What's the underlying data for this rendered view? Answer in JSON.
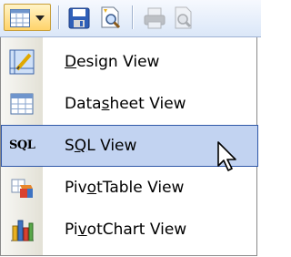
{
  "toolbar": {
    "buttons": [
      {
        "name": "view-dropdown-button",
        "icon": "datasheet-grid-icon"
      },
      {
        "name": "save-button",
        "icon": "save-disk-icon"
      },
      {
        "name": "file-search-button",
        "icon": "file-search-icon"
      },
      {
        "name": "print-button",
        "icon": "printer-icon"
      },
      {
        "name": "print-preview-button",
        "icon": "print-preview-icon"
      }
    ]
  },
  "menu": {
    "items": [
      {
        "id": "design",
        "pre": "",
        "key": "D",
        "post": "esign View",
        "icon": "design-view-icon"
      },
      {
        "id": "datasheet",
        "pre": "Data",
        "key": "s",
        "post": "heet View",
        "icon": "datasheet-view-icon"
      },
      {
        "id": "sql",
        "pre": "S",
        "key": "Q",
        "post": "L View",
        "icon": "sql-view-icon",
        "icon_text": "SQL",
        "highlighted": true
      },
      {
        "id": "pivottable",
        "pre": "Piv",
        "key": "o",
        "post": "tTable View",
        "icon": "pivottable-view-icon"
      },
      {
        "id": "pivotchart",
        "pre": "Pi",
        "key": "v",
        "post": "otChart View",
        "icon": "pivotchart-view-icon"
      }
    ]
  },
  "colors": {
    "highlight_bg": "#c2d3f1",
    "highlight_border": "#3058a8",
    "toolbar_active": "#ffd36a"
  }
}
